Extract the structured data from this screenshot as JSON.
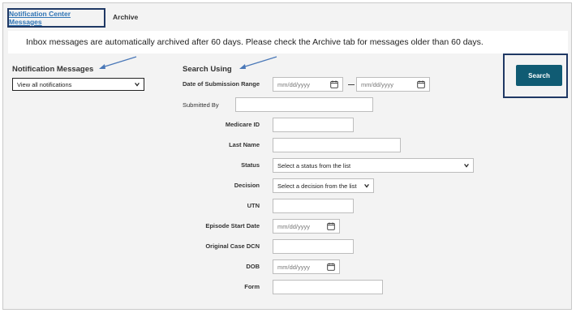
{
  "tabs": {
    "active_label": "Notification Center Messages",
    "archive_label": "Archive"
  },
  "banner": {
    "text": "Inbox messages are automatically archived after 60 days.  Please check the Archive tab for messages older than 60 days."
  },
  "left_panel": {
    "heading": "Notification Messages",
    "select_value": "View all notifications"
  },
  "search": {
    "heading": "Search Using",
    "button_label": "Search",
    "fields": {
      "submission_range": {
        "label": "Date of Submission Range",
        "from_placeholder": "mm/dd/yyyy",
        "to_placeholder": "mm/dd/yyyy"
      },
      "submitted_by": {
        "label": "Submitted By"
      },
      "medicare_id": {
        "label": "Medicare ID"
      },
      "last_name": {
        "label": "Last Name"
      },
      "status": {
        "label": "Status",
        "select_value": "Select a status from the list"
      },
      "decision": {
        "label": "Decision",
        "select_value": "Select a decision from the list"
      },
      "utn": {
        "label": "UTN"
      },
      "episode_start_date": {
        "label": "Episode Start Date",
        "placeholder": "mm/dd/yyyy"
      },
      "original_case_dcn": {
        "label": "Original Case DCN"
      },
      "dob": {
        "label": "DOB",
        "placeholder": "mm/dd/yyyy"
      },
      "form": {
        "label": "Form"
      }
    }
  },
  "colors": {
    "highlight_border": "#1f3864",
    "tab_link": "#2e74b5",
    "button_bg": "#105b73",
    "arrow": "#4a78b8"
  }
}
